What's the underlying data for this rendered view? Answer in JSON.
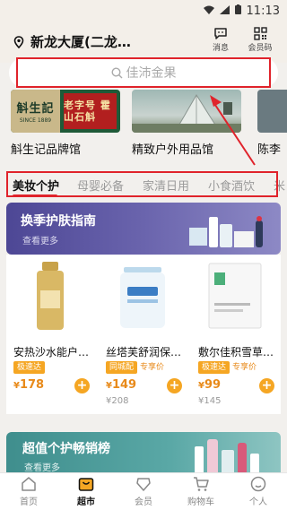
{
  "status_bar": {
    "time": "11:13"
  },
  "header": {
    "location": "新龙大厦(二龙…",
    "message_label": "消息",
    "member_code_label": "会员码"
  },
  "search": {
    "placeholder": "佳沛金果"
  },
  "stores": [
    {
      "name": "斛生记品牌馆",
      "logo_main": "斛生記",
      "logo_sub": "SINCE 1889",
      "logo_brand": "老字号 霍山石斛"
    },
    {
      "name": "精致户外用品馆"
    },
    {
      "name": "陈李"
    }
  ],
  "tabs": [
    {
      "label": "美妆个护",
      "active": true
    },
    {
      "label": "母婴必备",
      "active": false
    },
    {
      "label": "家清日用",
      "active": false
    },
    {
      "label": "小食酒饮",
      "active": false
    },
    {
      "label": "米",
      "active": false
    }
  ],
  "banner": {
    "title": "换季护肤指南",
    "subtitle": "查看更多"
  },
  "products": [
    {
      "name": "安热沙水能户…",
      "tags": [
        "极速达"
      ],
      "price": "178",
      "original_price": ""
    },
    {
      "name": "丝塔芙舒润保…",
      "tags": [
        "同城配",
        "专享价"
      ],
      "price": "149",
      "original_price": "¥208"
    },
    {
      "name": "敷尔佳积雪草…",
      "tags": [
        "极速达",
        "专享价"
      ],
      "price": "99",
      "original_price": "¥145"
    }
  ],
  "banner2": {
    "title": "超值个护畅销榜",
    "subtitle": "查看更多"
  },
  "bottom_nav": [
    {
      "label": "首页",
      "icon": "home-icon",
      "active": false
    },
    {
      "label": "超市",
      "icon": "supermarket-icon",
      "active": true
    },
    {
      "label": "会员",
      "icon": "member-icon",
      "active": false
    },
    {
      "label": "购物车",
      "icon": "cart-icon",
      "active": false
    },
    {
      "label": "个人",
      "icon": "profile-icon",
      "active": false
    }
  ],
  "colors": {
    "accent": "#e0232b",
    "price": "#e88a1a",
    "badge": "#f5a623",
    "banner": "#5b55a3"
  }
}
